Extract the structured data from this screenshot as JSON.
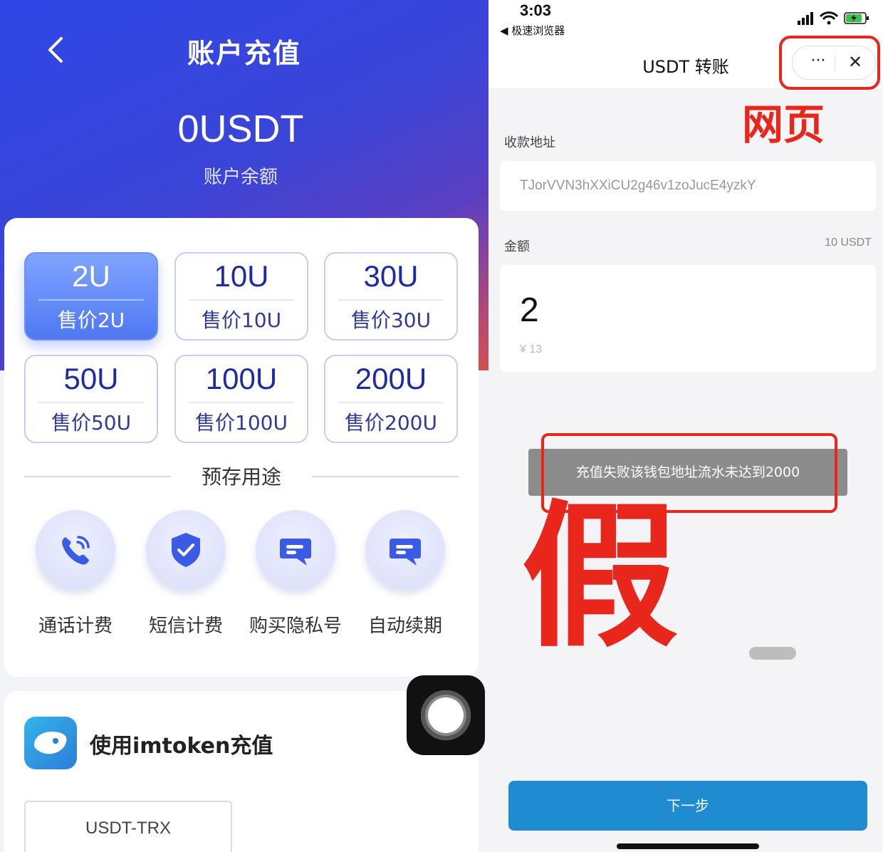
{
  "left": {
    "header": {
      "title": "账户充值"
    },
    "balance": {
      "value": "0USDT",
      "label": "账户余额"
    },
    "packages": [
      {
        "amount": "2U",
        "price": "售价2U",
        "selected": true
      },
      {
        "amount": "10U",
        "price": "售价10U",
        "selected": false
      },
      {
        "amount": "30U",
        "price": "售价30U",
        "selected": false
      },
      {
        "amount": "50U",
        "price": "售价50U",
        "selected": false
      },
      {
        "amount": "100U",
        "price": "售价100U",
        "selected": false
      },
      {
        "amount": "200U",
        "price": "售价200U",
        "selected": false
      }
    ],
    "section_label": "预存用途",
    "services": [
      {
        "label": "通话计费",
        "icon": "phone-icon"
      },
      {
        "label": "短信计费",
        "icon": "shield-check-icon"
      },
      {
        "label": "购买隐私号",
        "icon": "chat-bubble-icon"
      },
      {
        "label": "自动续期",
        "icon": "chat-bubble-icon"
      }
    ],
    "imtoken": {
      "label": "使用imtoken充值",
      "icon": "imtoken-logo-icon"
    },
    "network": "USDT-TRX"
  },
  "right": {
    "status_bar": {
      "time": "3:03",
      "back_app": "◀ 极速浏览器"
    },
    "nav": {
      "title": "USDT 转账",
      "more": "···",
      "close": "✕"
    },
    "address": {
      "label": "收款地址",
      "value": "TJorVVN3hXXiCU2g46v1zoJucE4yzkY"
    },
    "amount": {
      "label": "金额",
      "unit_hint": "10 USDT",
      "value": "2",
      "cny": "¥ 13"
    },
    "toast": "充值失败该钱包地址流水未达到2000",
    "next_button": "下一步",
    "annotations": {
      "web_label": "网页",
      "fake_label": "假",
      "color": "#e8261c"
    }
  },
  "colors": {
    "accent": "#2f46e6",
    "button": "#1f8bd0",
    "annotation": "#e8261c"
  }
}
